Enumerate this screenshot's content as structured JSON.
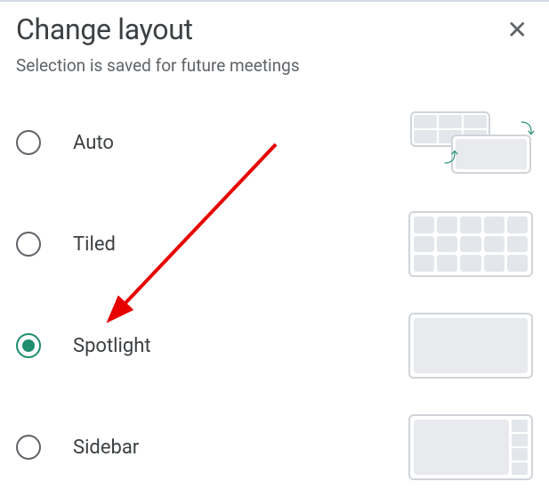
{
  "header": {
    "title": "Change layout",
    "subtitle": "Selection is saved for future meetings"
  },
  "options": [
    {
      "id": "auto",
      "label": "Auto",
      "selected": false
    },
    {
      "id": "tiled",
      "label": "Tiled",
      "selected": false
    },
    {
      "id": "spotlight",
      "label": "Spotlight",
      "selected": true
    },
    {
      "id": "sidebar",
      "label": "Sidebar",
      "selected": false
    }
  ],
  "annotation": {
    "type": "arrow",
    "color": "#e60000",
    "target": "spotlight"
  }
}
